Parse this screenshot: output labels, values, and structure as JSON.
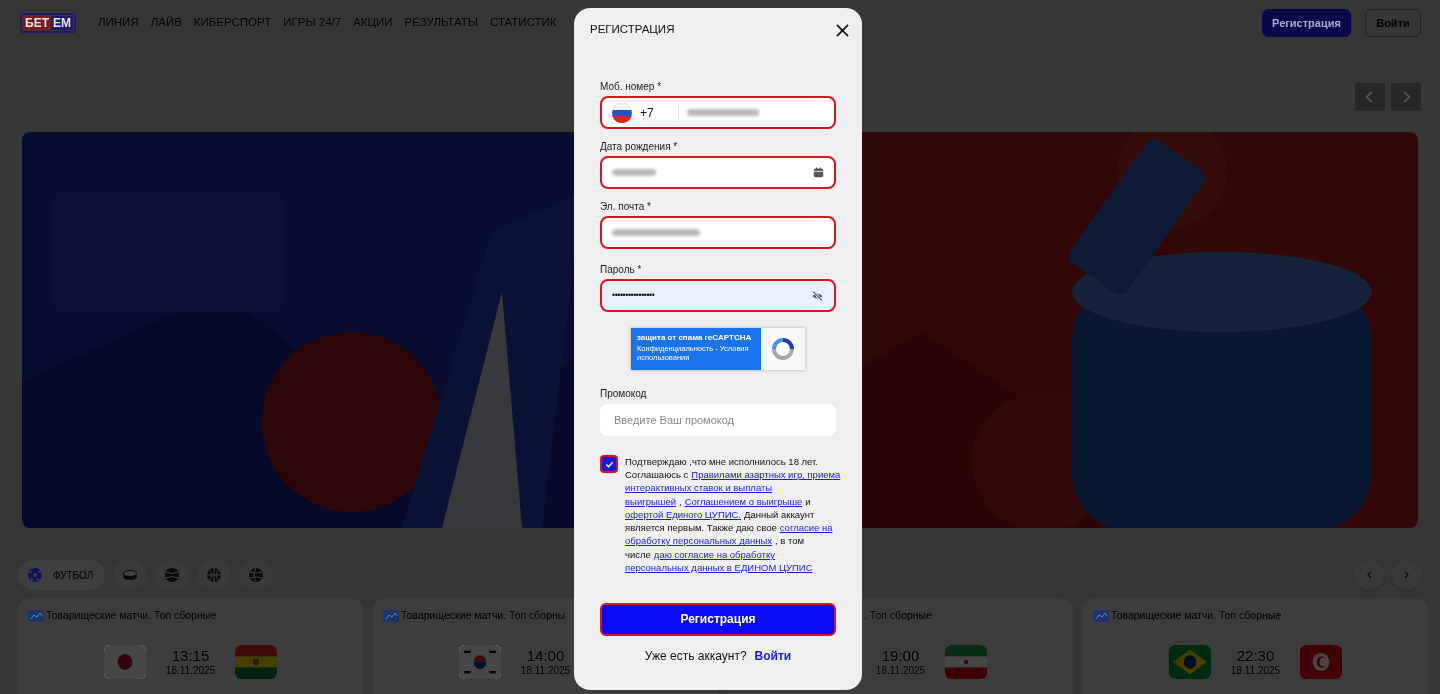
{
  "header": {
    "logo": [
      "БЕТ",
      "ЕМ"
    ],
    "nav": [
      "ЛИНИЯ",
      "ЛАЙВ",
      "КИБЕРСПОРТ",
      "ИГРЫ 24/7",
      "АКЦИИ",
      "РЕЗУЛЬТАТЫ",
      "СТАТИСТИК"
    ],
    "buttons": [
      {
        "label": "Регистрация",
        "kind": "primary"
      },
      {
        "label": "Войти",
        "kind": "outline"
      }
    ]
  },
  "sports": [
    {
      "label": "ФУТБОЛ",
      "selected": true
    },
    {
      "selected": false
    },
    {
      "selected": false
    },
    {
      "selected": false
    },
    {
      "selected": false
    }
  ],
  "matches": [
    {
      "league": "Товарищеские матчи. Топ сборные",
      "time": "13:15",
      "date": "18.11.2025"
    },
    {
      "league": "Товарищеские матчи. Топ сборны",
      "time": "14:00",
      "date": "18.11.2025"
    },
    {
      "league": ". Топ сборные",
      "time": "19:00",
      "date": "18.11.2025"
    },
    {
      "league": "Товарищеские матчи. Топ сборные",
      "time": "22:30",
      "date": "18.11.2025"
    }
  ],
  "modal": {
    "title": "РЕГИСТРАЦИЯ",
    "fields": [
      {
        "kind": "phone",
        "label": "Моб. номер *",
        "prefix": "+7",
        "invalid": true,
        "value_hidden": true
      },
      {
        "kind": "date",
        "label": "Дата рождения *",
        "invalid": true,
        "value_hidden": true
      },
      {
        "kind": "email",
        "label": "Эл. почта *",
        "invalid": true,
        "value_hidden": true
      },
      {
        "kind": "password",
        "label": "Пароль *",
        "invalid": true,
        "value": "••••••••••••••••",
        "autofilled": true
      }
    ],
    "captcha": {
      "title": "защита от спама reCAPTCHA",
      "links": "Конфиденциальность - Условия использования"
    },
    "promo": {
      "label": "Промокод",
      "placeholder": "Введите Ваш промокод",
      "invalid": false
    },
    "consent": {
      "checked": true,
      "invalid": true,
      "lines": [
        [
          {
            "text": "Подтверждаю ,что мне исполнилось 18 лет.",
            "link": false
          }
        ],
        [
          {
            "text": "Соглашаюсь с",
            "link": false
          },
          {
            "text": "Правилами азартных игр, приема",
            "link": true
          }
        ],
        [
          {
            "text": "интерактивных ставок и выплаты",
            "link": true
          }
        ],
        [
          {
            "text": "выигрышей",
            "link": true
          },
          {
            "text": ",",
            "link": false
          },
          {
            "text": "Соглашением о выигрыше",
            "link": true
          },
          {
            "text": "и",
            "link": false
          }
        ],
        [
          {
            "text": "офертой Единого ЦУПИС.",
            "link": true
          },
          {
            "text": "Данный аккаунт",
            "link": false
          }
        ],
        [
          {
            "text": "является первым. Также даю свое",
            "link": false
          },
          {
            "text": "согласие на",
            "link": true
          }
        ],
        [
          {
            "text": "обработку персональных данных",
            "link": true
          },
          {
            "text": ", в том",
            "link": false
          }
        ],
        [
          {
            "text": "числе",
            "link": false
          },
          {
            "text": "даю согласие на обработку",
            "link": true
          }
        ],
        [
          {
            "text": "персональных данных в ЕДИНОМ  ЦУПИС",
            "link": true
          }
        ]
      ]
    },
    "submit": {
      "label": "Регистрация",
      "invalid": true
    },
    "footer": {
      "text": "Уже есть аккаунт?",
      "link": "Войти"
    }
  }
}
